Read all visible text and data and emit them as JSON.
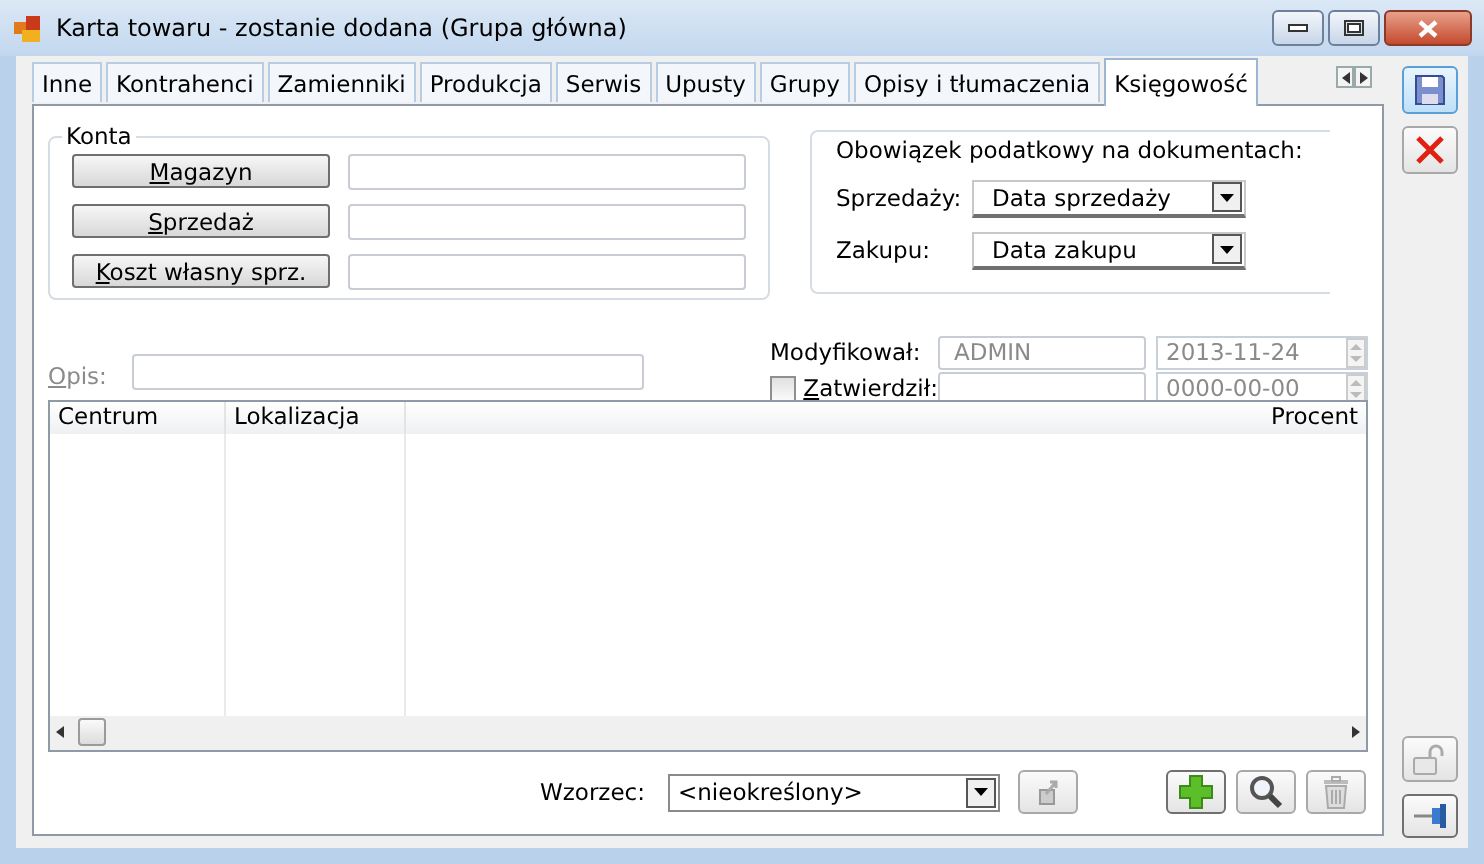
{
  "window": {
    "title": "Karta towaru - zostanie dodana (Grupa główna)"
  },
  "tabs": [
    {
      "label": "Inne",
      "selected": false
    },
    {
      "label": "Kontrahenci",
      "selected": false
    },
    {
      "label": "Zamienniki",
      "selected": false
    },
    {
      "label": "Produkcja",
      "selected": false
    },
    {
      "label": "Serwis",
      "selected": false
    },
    {
      "label": "Upusty",
      "selected": false
    },
    {
      "label": "Grupy",
      "selected": false
    },
    {
      "label": "Opisy i tłumaczenia",
      "selected": false
    },
    {
      "label": "Księgowość",
      "selected": true
    }
  ],
  "konta": {
    "title": "Konta",
    "rows": [
      {
        "button": "Magazyn"
      },
      {
        "button": "Sprzedaż"
      },
      {
        "button": "Koszt własny sprz."
      }
    ]
  },
  "tax": {
    "title": "Obowiązek podatkowy na dokumentach:",
    "fields": [
      {
        "label": "Sprzedaży:",
        "value": "Data sprzedaży"
      },
      {
        "label": "Zakupu:",
        "value": "Data zakupu"
      }
    ]
  },
  "modified": {
    "label": "Modyfikował:",
    "user": "ADMIN",
    "date": "2013-11-24"
  },
  "approved": {
    "label": "Zatwierdził:",
    "checked": false,
    "date": "0000-00-00"
  },
  "description": {
    "label": "Opis:"
  },
  "table": {
    "columns": [
      "Centrum",
      "Lokalizacja",
      "Procent"
    ]
  },
  "template": {
    "label": "Wzorzec:",
    "value": "<nieokreślony>"
  }
}
